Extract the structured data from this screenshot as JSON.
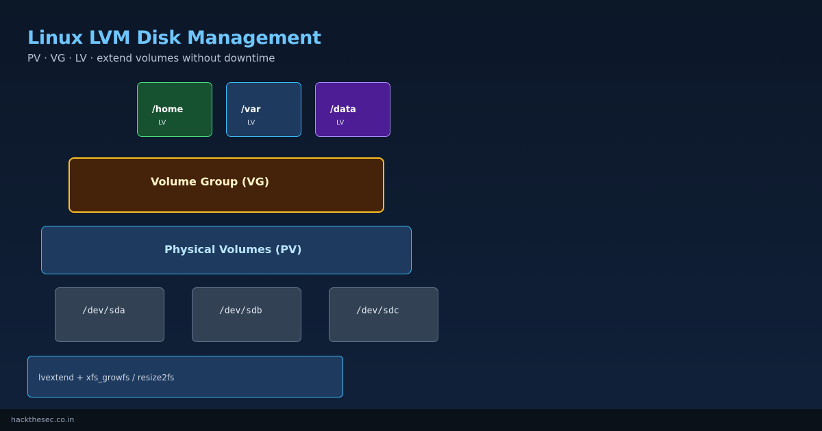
{
  "header": {
    "title": "Linux LVM Disk Management",
    "subtitle": "PV · VG · LV · extend volumes without downtime"
  },
  "logical_volumes": [
    {
      "name": "/home",
      "tag": "LV",
      "color": "#4ade80"
    },
    {
      "name": "/var",
      "tag": "LV",
      "color": "#38bdf8"
    },
    {
      "name": "/data",
      "tag": "LV",
      "color": "#a78bfa"
    }
  ],
  "volume_group": {
    "label": "Volume Group (VG)",
    "color": "#fbbf24"
  },
  "physical_volumes": {
    "label": "Physical Volumes (PV)",
    "color": "#38bdf8"
  },
  "disks": [
    {
      "label": "/dev/sda"
    },
    {
      "label": "/dev/sdb"
    },
    {
      "label": "/dev/sdc"
    }
  ],
  "command": {
    "text": "lvextend + xfs_growfs / resize2fs"
  },
  "footer": {
    "text": "hackthesec.co.in"
  }
}
